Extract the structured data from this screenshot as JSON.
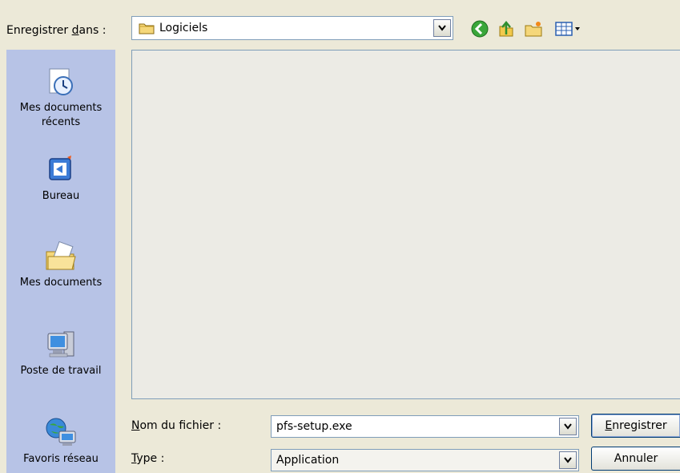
{
  "toolbar": {
    "save_in_label_pre": "Enregistrer ",
    "save_in_label_key": "d",
    "save_in_label_post": "ans :",
    "current_folder": "Logiciels"
  },
  "places": [
    {
      "label_line1": "Mes documents",
      "label_line2": "récents",
      "icon": "recent-documents-icon"
    },
    {
      "label_line1": "Bureau",
      "label_line2": "",
      "icon": "desktop-icon"
    },
    {
      "label_line1": "Mes documents",
      "label_line2": "",
      "icon": "my-documents-icon"
    },
    {
      "label_line1": "Poste de travail",
      "label_line2": "",
      "icon": "my-computer-icon"
    },
    {
      "label_line1": "Favoris réseau",
      "label_line2": "",
      "icon": "network-places-icon"
    }
  ],
  "filename": {
    "label_key": "N",
    "label_rest": "om du fichier :",
    "value": "pfs-setup.exe"
  },
  "type": {
    "label_key": "T",
    "label_rest": "ype :",
    "value": "Application"
  },
  "buttons": {
    "save_key": "E",
    "save_rest": "nregistrer",
    "cancel": "Annuler"
  },
  "colors": {
    "places_bar": "#b7c3e6",
    "dialog_bg": "#ece9d8",
    "list_bg": "#ecebe5"
  }
}
